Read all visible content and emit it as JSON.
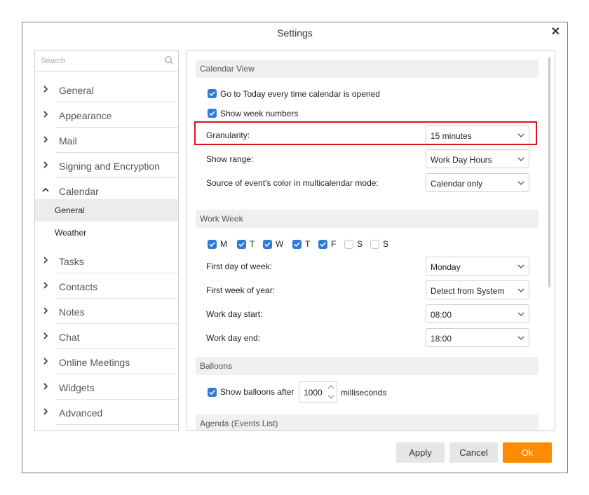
{
  "window": {
    "title": "Settings",
    "close_symbol": "✕"
  },
  "search": {
    "placeholder": "Search"
  },
  "sidebar": {
    "items": [
      {
        "label": "General"
      },
      {
        "label": "Appearance"
      },
      {
        "label": "Mail"
      },
      {
        "label": "Signing and Encryption"
      },
      {
        "label": "Calendar",
        "expanded": true
      },
      {
        "label": "Tasks"
      },
      {
        "label": "Contacts"
      },
      {
        "label": "Notes"
      },
      {
        "label": "Chat"
      },
      {
        "label": "Online Meetings"
      },
      {
        "label": "Widgets"
      },
      {
        "label": "Advanced"
      }
    ],
    "calendar_sub": [
      {
        "label": "General",
        "active": true
      },
      {
        "label": "Weather"
      }
    ]
  },
  "calendar_view": {
    "header": "Calendar View",
    "goto_today": {
      "label": "Go to Today every time calendar is opened",
      "checked": true
    },
    "show_week_numbers": {
      "label": "Show week numbers",
      "checked": true
    },
    "granularity": {
      "label": "Granularity:",
      "value": "15 minutes"
    },
    "show_range": {
      "label": "Show range:",
      "value": "Work Day Hours"
    },
    "event_color": {
      "label": "Source of event's color in multicalendar mode:",
      "value": "Calendar only"
    }
  },
  "work_week": {
    "header": "Work Week",
    "days": [
      {
        "label": "M",
        "checked": true
      },
      {
        "label": "T",
        "checked": true
      },
      {
        "label": "W",
        "checked": true
      },
      {
        "label": "T",
        "checked": true
      },
      {
        "label": "F",
        "checked": true
      },
      {
        "label": "S",
        "checked": false
      },
      {
        "label": "S",
        "checked": false
      }
    ],
    "first_day": {
      "label": "First day of week:",
      "value": "Monday"
    },
    "first_week": {
      "label": "First week of year:",
      "value": "Detect from System"
    },
    "day_start": {
      "label": "Work day start:",
      "value": "08:00"
    },
    "day_end": {
      "label": "Work day end:",
      "value": "18:00"
    }
  },
  "balloons": {
    "header": "Balloons",
    "show_after": {
      "label": "Show balloons after",
      "checked": true,
      "value": "1000",
      "unit": "milliseconds"
    }
  },
  "agenda": {
    "header": "Agenda (Events List)"
  },
  "buttons": {
    "apply": "Apply",
    "cancel": "Cancel",
    "ok": "Ok"
  },
  "colors": {
    "accent": "#2e7bd6",
    "ok_button": "#ff8c00",
    "highlight": "#d9141b"
  }
}
